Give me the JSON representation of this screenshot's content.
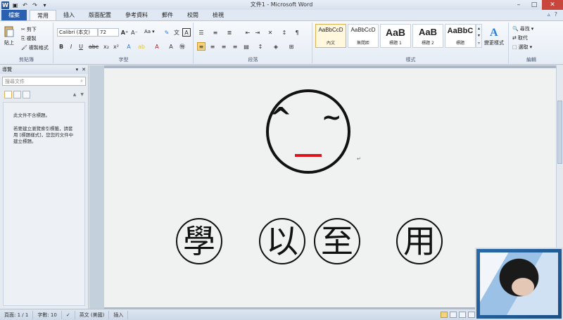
{
  "window": {
    "title": "文件1 - Microsoft Word",
    "quick_access": [
      "word-logo-icon",
      "save-icon",
      "undo-icon",
      "redo-icon",
      "customize-icon"
    ]
  },
  "tabs": [
    "檔案",
    "常用",
    "插入",
    "版面配置",
    "參考資料",
    "郵件",
    "校閱",
    "檢視"
  ],
  "active_tab": "常用",
  "ribbon": {
    "clipboard": {
      "label": "剪貼簿",
      "paste": "貼上",
      "cut": "剪下",
      "copy": "複製",
      "format_painter": "複製格式"
    },
    "font": {
      "label": "字型",
      "font_name": "Calibri (本文)",
      "font_size": "72",
      "case_button": "Aa"
    },
    "paragraph": {
      "label": "段落"
    },
    "styles": {
      "label": "樣式",
      "items": [
        {
          "sample": "AaBbCcD",
          "name": "內文"
        },
        {
          "sample": "AaBbCcD",
          "name": "無間距"
        },
        {
          "sample": "AaB",
          "name": "標題 1"
        },
        {
          "sample": "AaB",
          "name": "標題 2"
        },
        {
          "sample": "AaBbC",
          "name": "標題"
        }
      ],
      "change_styles": "變更樣式"
    },
    "editing": {
      "label": "編輯",
      "find": "尋找",
      "replace": "取代",
      "select": "選取"
    }
  },
  "navigation": {
    "title": "導覽",
    "search_placeholder": "搜尋文件",
    "message1": "此文件不含標題。",
    "message2": "若要建立瀏覽索引標籤，請套用 [標題樣式]，您您的文件中建立標題。"
  },
  "document": {
    "face_left_eye": "^",
    "face_right_eye": "~",
    "characters": [
      "學",
      "以",
      "至",
      "用"
    ],
    "paragraph_mark": "↵"
  },
  "statusbar": {
    "page": "頁面: 1 / 1",
    "words": "字數: 10",
    "language": "英文 (美國)",
    "mode": "插入"
  },
  "colors": {
    "accent": "#2b5fb0",
    "mouth": "#e2121a"
  }
}
